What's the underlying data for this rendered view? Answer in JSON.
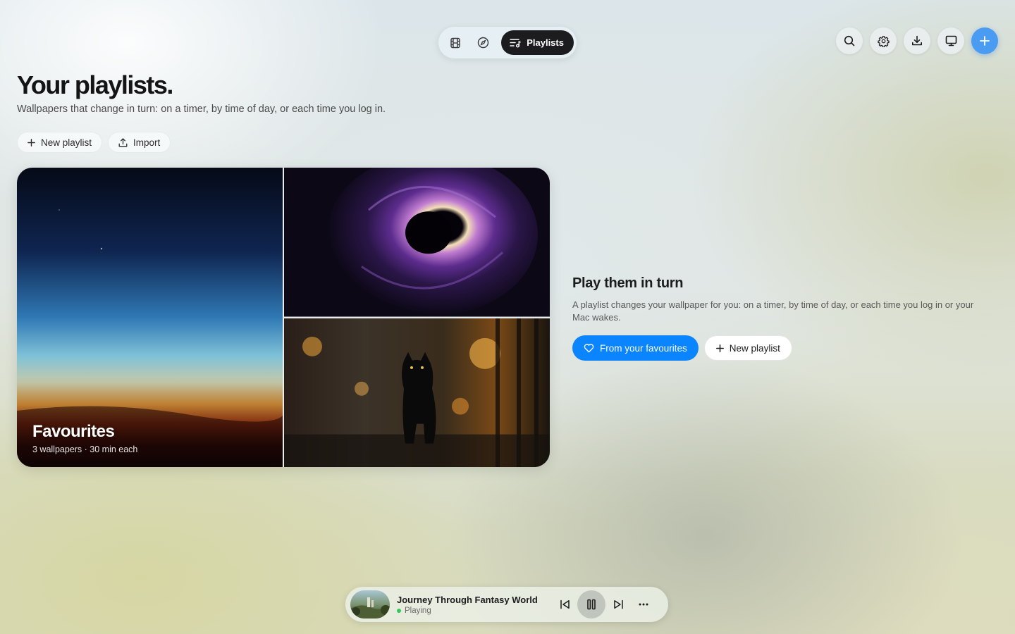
{
  "nav": {
    "tabs": [
      {
        "icon": "film-icon",
        "label": ""
      },
      {
        "icon": "compass-icon",
        "label": ""
      },
      {
        "icon": "playlist-icon",
        "label": "Playlists",
        "active": true
      }
    ]
  },
  "toolbar": {
    "icons": [
      "search-icon",
      "gear-icon",
      "download-icon",
      "display-icon",
      "plus-icon"
    ]
  },
  "header": {
    "title": "Your playlists.",
    "subtitle": "Wallpapers that change in turn: on a timer, by time of day, or each time you log in.",
    "new_playlist_label": "New playlist",
    "import_label": "Import"
  },
  "playlist_card": {
    "title": "Favourites",
    "meta": "3 wallpapers · 30 min each",
    "thumbnails": [
      "crescent-moon-sunset",
      "black-hole-swirl",
      "black-cat-street"
    ]
  },
  "promo": {
    "title": "Play them in turn",
    "description": "A playlist changes your wallpaper for you: on a timer, by time of day, or each time you log in or your Mac wakes.",
    "primary_label": "From your favourites",
    "secondary_label": "New playlist"
  },
  "now_playing": {
    "title": "Journey Through Fantasy World",
    "status": "Playing",
    "status_color": "#34c759"
  },
  "colors": {
    "accent": "#0a84ff",
    "add_button": "#4a9bf2",
    "active_tab": "#1c1c1e"
  }
}
